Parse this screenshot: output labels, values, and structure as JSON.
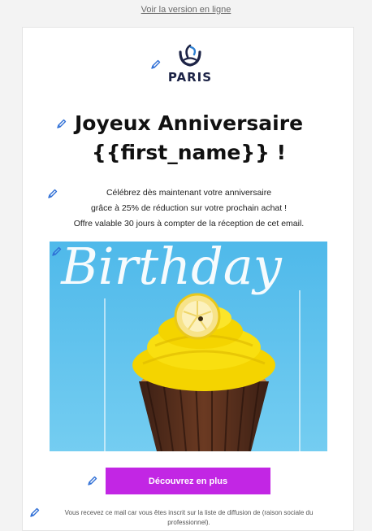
{
  "header": {
    "online_link_label": "Voir la version en ligne"
  },
  "logo": {
    "text": "PARIS"
  },
  "headline": {
    "line1": "Joyeux Anniversaire",
    "line2": "{{first_name}} !"
  },
  "body": {
    "line1": "Célébrez dès maintenant votre anniversaire",
    "line2": "grâce à 25% de réduction sur votre prochain achat !",
    "line3": "Offre valable 30 jours à compter de la réception de cet email."
  },
  "hero": {
    "script_text": "Birthday"
  },
  "cta": {
    "label": "Découvrez en plus"
  },
  "footer": {
    "text": "Vous recevez ce mail car vous êtes inscrit sur la liste de diffusion de (raison sociale du professionnel)."
  },
  "colors": {
    "accent": "#c226e4",
    "edit_icon": "#2f6fd6",
    "logo_navy": "#1c2346",
    "hero_blue": "#5ec2ec",
    "frosting_yellow": "#f5d800"
  },
  "icons": {
    "edit": "pencil-edit-icon",
    "logo": "paris-boat-logo"
  }
}
